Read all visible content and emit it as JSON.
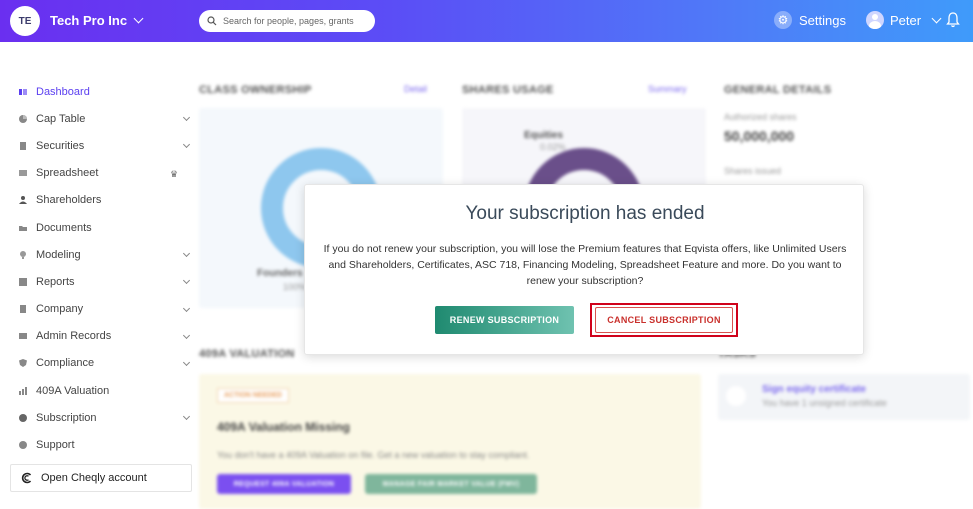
{
  "header": {
    "avatar_initials": "TE",
    "company_name": "Tech Pro Inc",
    "search_placeholder": "Search for people, pages, grants",
    "settings_label": "Settings",
    "user_name": "Peter",
    "colors": {
      "gradient_start": "#6a2ff0",
      "gradient_end": "#3f9bfa"
    }
  },
  "sidebar": {
    "items": [
      {
        "label": "Dashboard",
        "icon": "dashboard-icon",
        "active": true,
        "expandable": false
      },
      {
        "label": "Cap Table",
        "icon": "pie-chart-icon",
        "active": false,
        "expandable": true
      },
      {
        "label": "Securities",
        "icon": "document-icon",
        "active": false,
        "expandable": true
      },
      {
        "label": "Spreadsheet",
        "icon": "spreadsheet-icon",
        "active": false,
        "expandable": false,
        "badge_icon": "crown-icon"
      },
      {
        "label": "Shareholders",
        "icon": "person-icon",
        "active": false,
        "expandable": false
      },
      {
        "label": "Documents",
        "icon": "folder-icon",
        "active": false,
        "expandable": false
      },
      {
        "label": "Modeling",
        "icon": "bulb-icon",
        "active": false,
        "expandable": true
      },
      {
        "label": "Reports",
        "icon": "report-icon",
        "active": false,
        "expandable": true
      },
      {
        "label": "Company",
        "icon": "building-icon",
        "active": false,
        "expandable": true
      },
      {
        "label": "Admin Records",
        "icon": "records-icon",
        "active": false,
        "expandable": true
      },
      {
        "label": "Compliance",
        "icon": "shield-icon",
        "active": false,
        "expandable": true
      },
      {
        "label": "409A Valuation",
        "icon": "chart-icon",
        "active": false,
        "expandable": false
      },
      {
        "label": "Subscription",
        "icon": "dollar-icon",
        "active": false,
        "expandable": true
      },
      {
        "label": "Support",
        "icon": "support-icon",
        "active": false,
        "expandable": false
      }
    ],
    "cheqly_label": "Open Cheqly account"
  },
  "dashboard": {
    "class_ownership": {
      "title": "CLASS OWNERSHIP",
      "link": "Detail",
      "legend": "Founders",
      "legend_value": "100%"
    },
    "shares_usage": {
      "title": "SHARES USAGE",
      "link": "Summary",
      "legend": "Equities",
      "legend_value": "0.02%"
    },
    "general_details": {
      "title": "GENERAL DETAILS",
      "authorized_label": "Authorized shares",
      "authorized_value": "50,000,000",
      "issued_label": "Shares issued"
    },
    "valuation": {
      "title": "409A VALUATION",
      "badge": "ACTION NEEDED",
      "heading": "409A Valuation Missing",
      "text": "You don't have a 409A Valuation on file. Get a new valuation to stay compliant.",
      "request_button": "REQUEST 409A VALUATION",
      "manage_button": "MANAGE FAIR MARKET VALUE (FMV)"
    },
    "tasks": {
      "title": "TASKS",
      "item_title": "Sign equity certificate",
      "item_text": "You have 1 unsigned certificate"
    }
  },
  "modal": {
    "title": "Your subscription has ended",
    "body": "If you do not renew your subscription, you will lose the Premium features that Eqvista offers, like Unlimited Users and Shareholders, Certificates, ASC 718, Financing Modeling, Spreadsheet Feature and more. Do you want to renew your subscription?",
    "renew_label": "RENEW SUBSCRIPTION",
    "cancel_label": "CANCEL SUBSCRIPTION",
    "colors": {
      "renew": "#1f8a70",
      "cancel": "#c9302c",
      "highlight": "#d0021b"
    }
  }
}
